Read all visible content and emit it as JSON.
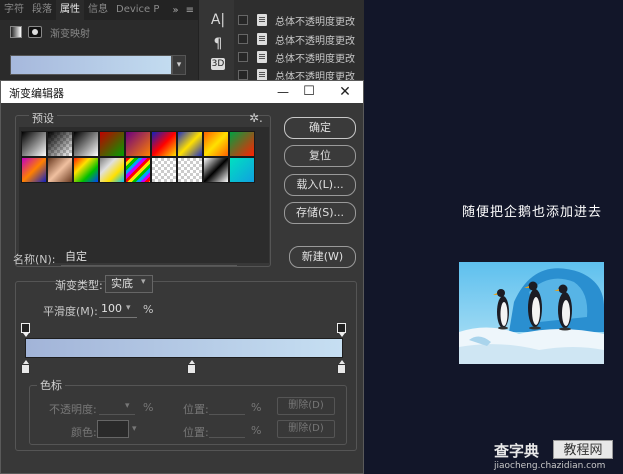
{
  "props_panel": {
    "tabs": [
      "字符",
      "段落",
      "属性",
      "信息",
      "Device P"
    ],
    "active_tab": "属性",
    "overflow": "»",
    "menu": "≡",
    "gradient_map_label": "渐变映射",
    "gradient_colors": [
      "#a6b8dc",
      "#c3dcf0"
    ]
  },
  "toolstrip": {
    "char_icon": "A|",
    "para_icon": "¶",
    "cube_icon": "3D"
  },
  "history": {
    "items": [
      "总体不透明度更改",
      "总体不透明度更改",
      "总体不透明度更改",
      "总体不透明度更改"
    ]
  },
  "dialog": {
    "title": "渐变编辑器",
    "minimize": "—",
    "maximize": "☐",
    "close": "✕",
    "presets_label": "预设",
    "gear": "✲.",
    "buttons": {
      "ok": "确定",
      "reset": "复位",
      "load": "载入(L)...",
      "save": "存储(S)...",
      "new": "新建(W)"
    },
    "name_label": "名称(N):",
    "name_value": "自定",
    "type_label": "渐变类型:",
    "type_value": "实底",
    "smoothness_label": "平滑度(M):",
    "smoothness_value": "100",
    "smoothness_unit": "%",
    "gradient_colors": [
      "#a2b4d8",
      "#c6dff2"
    ],
    "stops_label": "色标",
    "opacity_label": "不透明度:",
    "percent": "%",
    "location_label": "位置:",
    "delete_label": "删除(D)",
    "color_label": "颜色:"
  },
  "caption": "随便把企鹅也添加进去",
  "watermark": {
    "main": "查字典",
    "box": "教程网",
    "url": "jiaocheng.chazidian.com"
  }
}
